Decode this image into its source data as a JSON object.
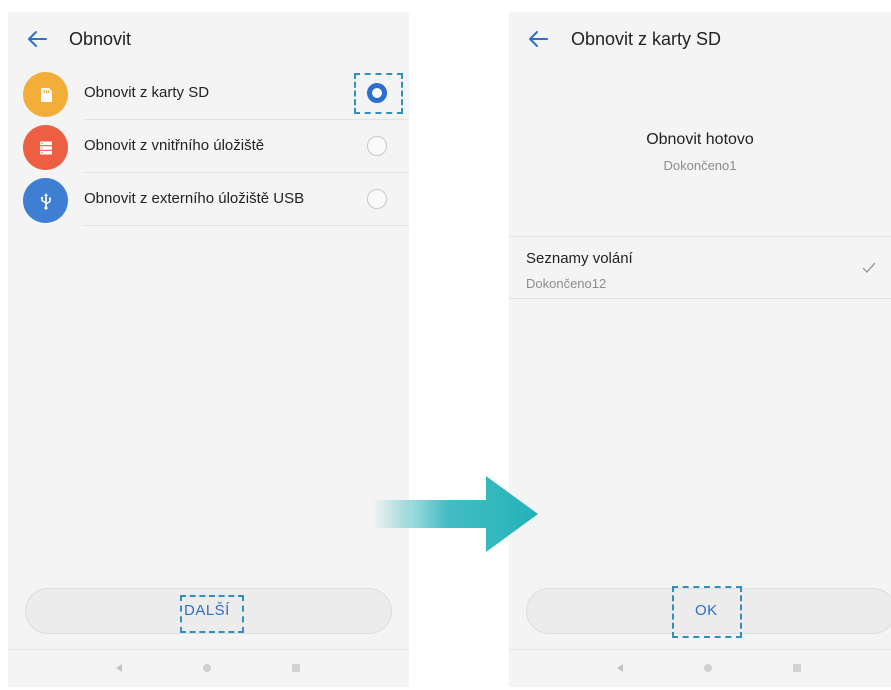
{
  "left_screen": {
    "title": "Obnovit",
    "options": [
      {
        "label": "Obnovit z karty SD",
        "icon": "sd-card-icon",
        "color": "#f3ae3a",
        "selected": true
      },
      {
        "label": "Obnovit z vnitřního úložiště",
        "icon": "storage-icon",
        "color": "#ec5f43",
        "selected": false
      },
      {
        "label": "Obnovit z externího úložiště USB",
        "icon": "usb-icon",
        "color": "#3e7fd3",
        "selected": false
      }
    ],
    "next_button": "DALŠÍ"
  },
  "right_screen": {
    "title": "Obnovit z karty SD",
    "status_title": "Obnovit hotovo",
    "status_subtitle": "Dokončeno1",
    "item": {
      "title": "Seznamy volání",
      "subtitle": "Dokončeno12",
      "icon": "checkmark-icon"
    },
    "ok_button": "OK"
  },
  "colors": {
    "accent": "#2c6fce",
    "highlight_dash": "#2f8fbf",
    "arrow": "#23b2b8"
  }
}
